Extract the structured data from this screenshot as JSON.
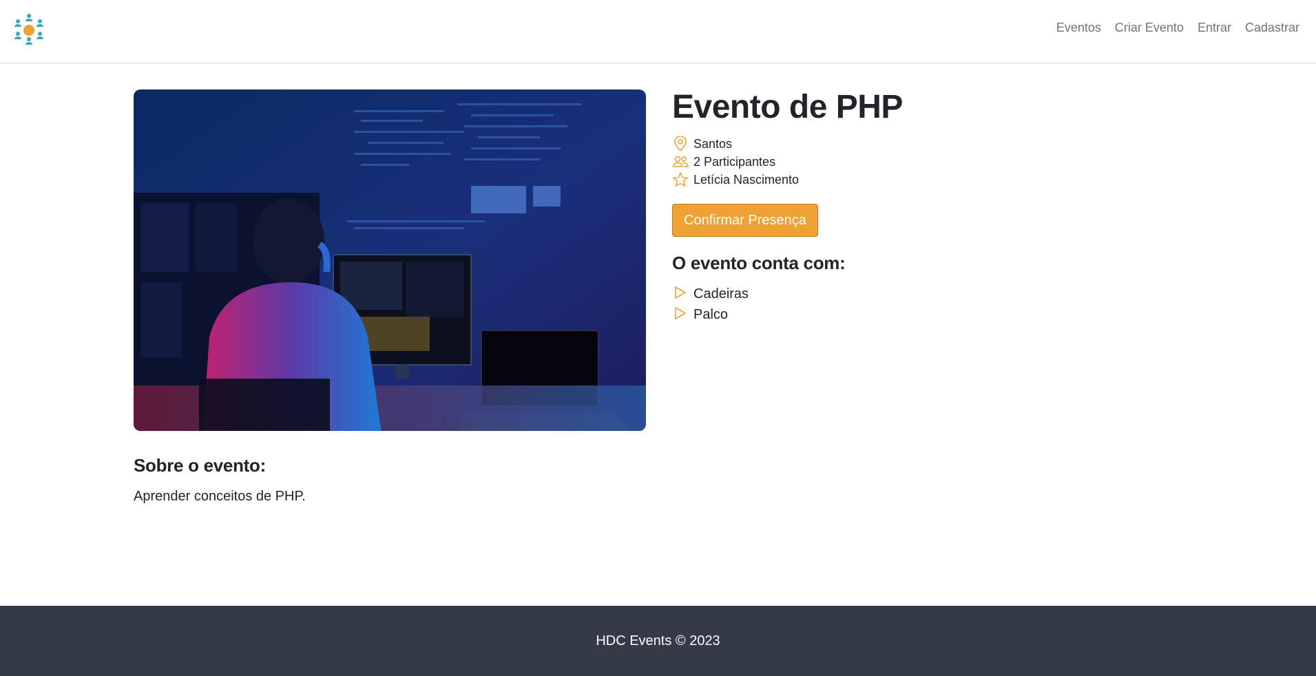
{
  "brand": {
    "logo_icon": "people-network-logo",
    "accent_color": "#f0a134"
  },
  "nav": {
    "links": [
      "Eventos",
      "Criar Evento",
      "Entrar",
      "Cadastrar"
    ]
  },
  "event": {
    "title": "Evento de PHP",
    "city": "Santos",
    "participants": "2 Participantes",
    "owner": "Letícia Nascimento",
    "confirm_label": "Confirmar Presença",
    "items_title": "O evento conta com:",
    "items": [
      "Cadeiras",
      "Palco"
    ],
    "about_title": "Sobre o evento:",
    "description": "Aprender conceitos de PHP.",
    "image_subject": "developer-at-computer-photo"
  },
  "icons": {
    "location": "geo-pin-icon",
    "participants": "people-icon",
    "owner": "star-icon",
    "item": "play-triangle-icon"
  },
  "footer": {
    "text": "HDC Events © 2023",
    "background": "#343a46"
  }
}
